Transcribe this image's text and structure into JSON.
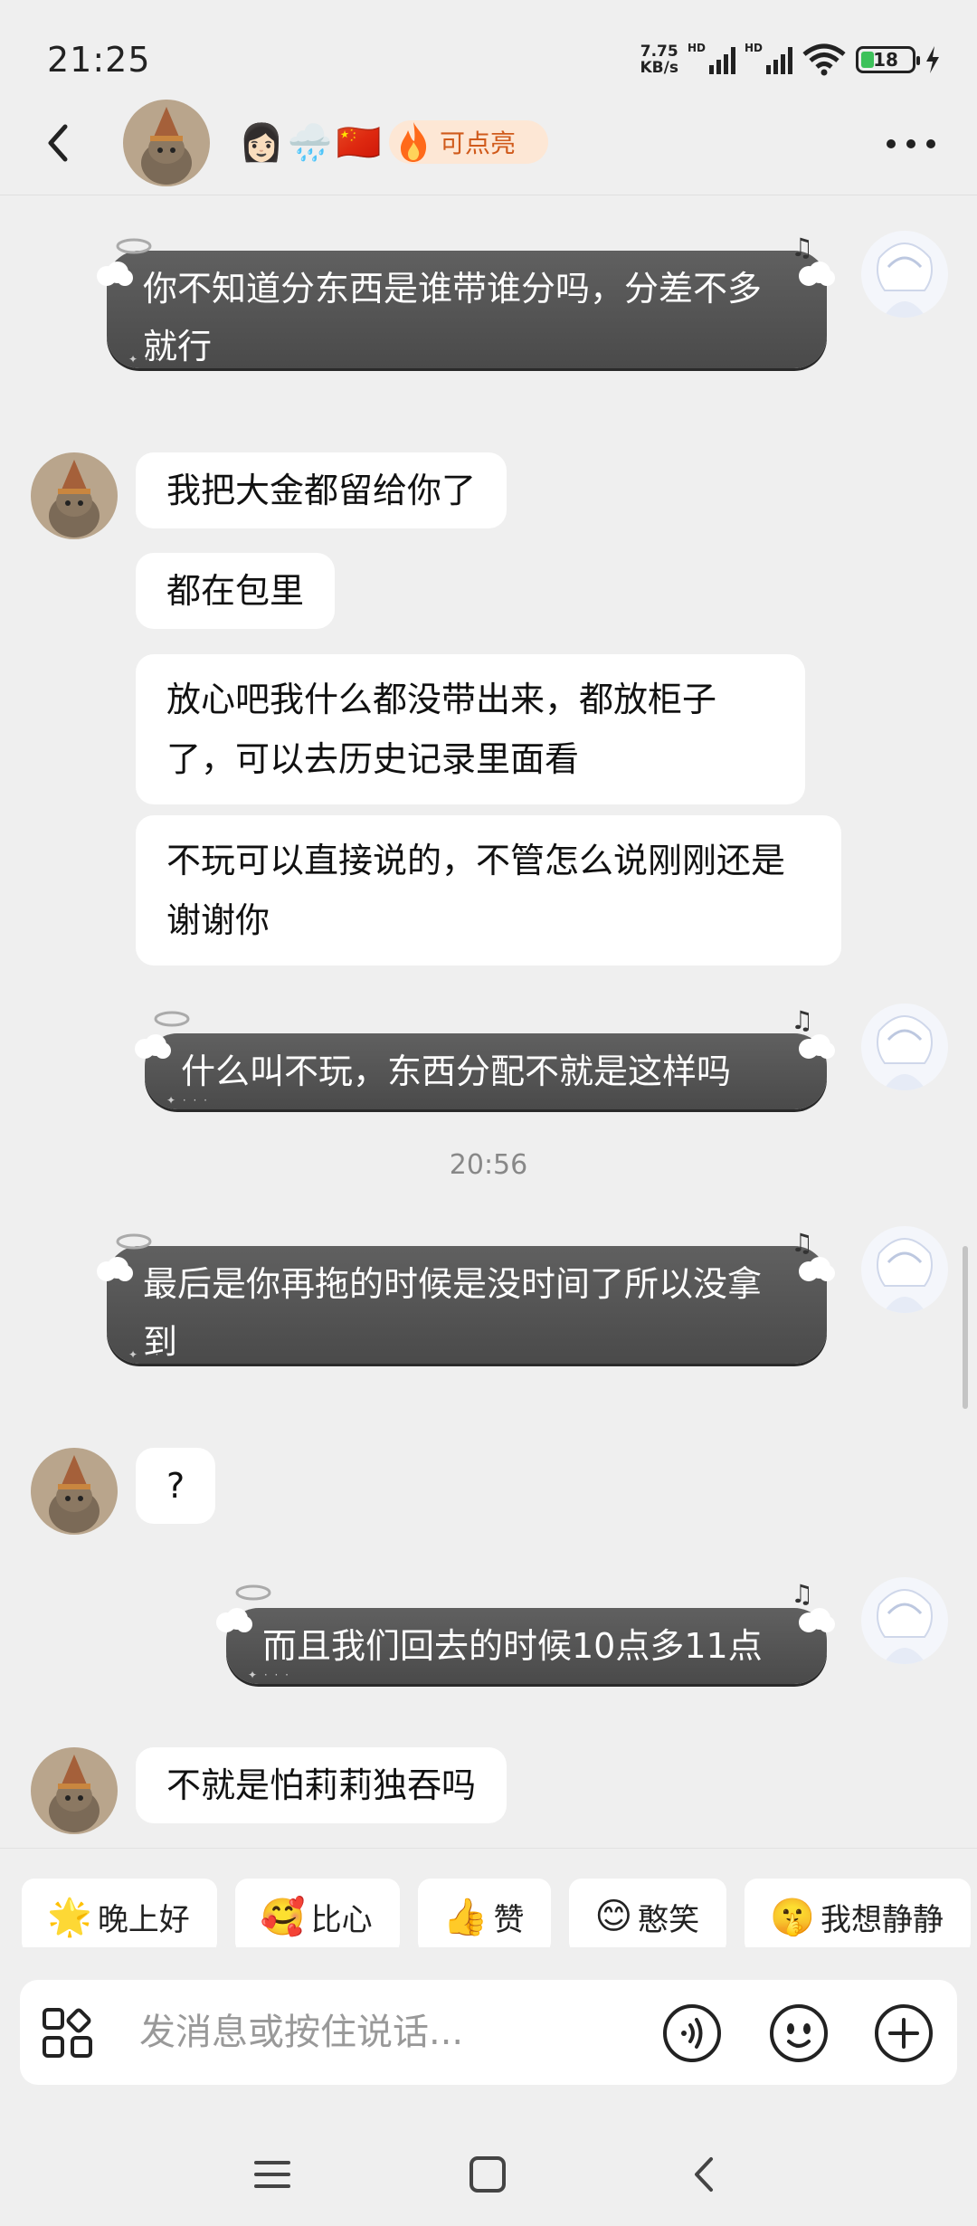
{
  "status_bar": {
    "time": "21:25",
    "net_speed_value": "7.75",
    "net_speed_unit": "KB/s",
    "hd": "HD",
    "battery": "18"
  },
  "header": {
    "status_emojis": [
      "👩🏻",
      "🌧️",
      "🇨🇳"
    ],
    "flame_label": "可点亮"
  },
  "messages": [
    {
      "side": "right",
      "text": "你不知道分东西是谁带谁分吗，分差不多就行"
    },
    {
      "side": "left",
      "text": "我把大金都留给你了"
    },
    {
      "side": "left",
      "text": "都在包里"
    },
    {
      "side": "left",
      "text": "放心吧我什么都没带出来，都放柜子了，可以去历史记录里面看"
    },
    {
      "side": "left",
      "text": "不玩可以直接说的，不管怎么说刚刚还是谢谢你"
    },
    {
      "side": "right",
      "text": "什么叫不玩，东西分配不就是这样吗"
    },
    {
      "side": "right",
      "text": "最后是你再拖的时候是没时间了所以没拿到"
    },
    {
      "side": "left",
      "text": "?"
    },
    {
      "side": "right",
      "text": "而且我们回去的时候10点多11点"
    },
    {
      "side": "left",
      "text": "不就是怕莉莉独吞吗"
    }
  ],
  "timestamp": "20:56",
  "quick_replies": [
    {
      "emoji": "🌟",
      "label": "晚上好"
    },
    {
      "emoji": "🥰",
      "label": "比心"
    },
    {
      "emoji": "👍",
      "label": "赞"
    },
    {
      "emoji": "😊",
      "label": "憨笑"
    },
    {
      "emoji": "🤫",
      "label": "我想静静"
    }
  ],
  "input": {
    "placeholder": "发消息或按住说话..."
  }
}
